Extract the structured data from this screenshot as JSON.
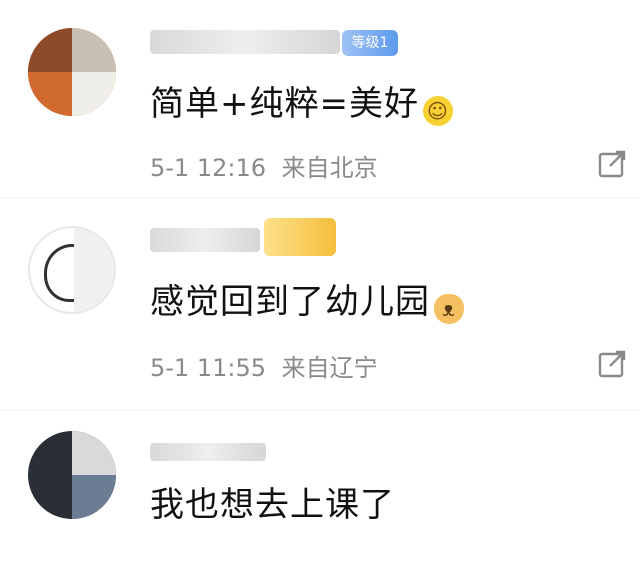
{
  "comments": [
    {
      "badge": "等级1",
      "text": "简单+纯粹=美好",
      "emoji": "smile-emoji",
      "time": "5-1 12:16",
      "location": "来自北京"
    },
    {
      "badge": "",
      "text": "感觉回到了幼儿园",
      "emoji": "dog-emoji",
      "time": "5-1 11:55",
      "location": "来自辽宁"
    },
    {
      "text": "我也想去上课了"
    }
  ],
  "colors": {
    "meta_gray": "#8a8a8a",
    "badge_blue": "#5b9bec",
    "badge_yellow": "#f5bf3c"
  },
  "icons": {
    "share": "share-icon",
    "smile": "smile-emoji",
    "dog": "dog-emoji"
  }
}
